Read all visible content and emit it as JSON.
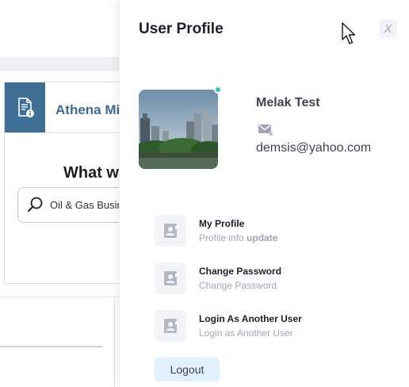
{
  "background": {
    "card_title": "Athena Mi",
    "card_heading": "What w",
    "search_value": "Oil & Gas Busin"
  },
  "panel": {
    "title": "User Profile",
    "close_label": "X",
    "user": {
      "name": "Melak Test",
      "email": "demsis@yahoo.com",
      "online": true
    },
    "menu": [
      {
        "title": "My Profile",
        "sub_text": "Profile info ",
        "sub_bold": "update"
      },
      {
        "title": "Change Password",
        "sub_text": "Change Password",
        "sub_bold": ""
      },
      {
        "title": "Login As Another User",
        "sub_text": "Login as Another User",
        "sub_bold": ""
      }
    ],
    "logout_label": "Logout"
  },
  "colors": {
    "accent_dark": "#3f6f94",
    "online": "#2ec4b6",
    "logout_bg": "#e1f0ff"
  },
  "icons": {
    "card": "document-info-icon",
    "search": "search-icon",
    "mail": "mail-icon",
    "menu": "contact-card-icon",
    "cursor": "mouse-cursor-icon"
  }
}
